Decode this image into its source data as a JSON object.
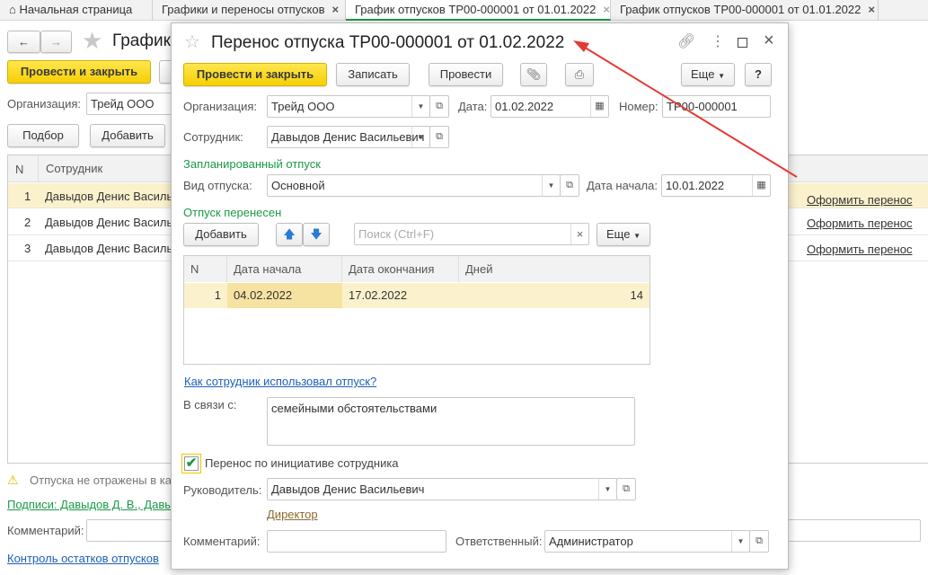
{
  "tabs": [
    {
      "label": "Начальная страница",
      "icon": "home-icon"
    },
    {
      "label": "Графики и переносы отпусков",
      "close": "×"
    },
    {
      "label": "График отпусков ТР00-000001 от 01.01.2022",
      "close": "×",
      "active": true
    },
    {
      "label": "График отпусков ТР00-000001 от 01.01.2022",
      "close": "×"
    }
  ],
  "bg": {
    "title": "График",
    "post_close": "Провести и закрыть",
    "org_label": "Организация:",
    "org_value": "Трейд ООО",
    "pick": "Подбор",
    "add": "Добавить",
    "col_n": "N",
    "col_emp": "Сотрудник",
    "rows": [
      {
        "n": "1",
        "emp": "Давыдов Денис Василь",
        "action": "Оформить перенос"
      },
      {
        "n": "2",
        "emp": "Давыдов Денис Василь",
        "action": "Оформить перенос"
      },
      {
        "n": "3",
        "emp": "Давыдов Денис Василь",
        "action": "Оформить перенос"
      }
    ],
    "warning": "Отпуска не отражены в ка",
    "signatures": "Подписи: Давыдов Д. В., Давы",
    "comment_label": "Комментарий:",
    "control_link": "Контроль остатков отпусков"
  },
  "modal": {
    "title": "Перенос отпуска ТР00-000001 от 01.02.2022",
    "toolbar": {
      "post_close": "Провести и закрыть",
      "save": "Записать",
      "post": "Провести",
      "more": "Еще",
      "help": "?"
    },
    "org_label": "Организация:",
    "org_value": "Трейд ООО",
    "date_label": "Дата:",
    "date_value": "01.02.2022",
    "num_label": "Номер:",
    "num_value": "ТР00-000001",
    "emp_label": "Сотрудник:",
    "emp_value": "Давыдов Денис Васильевич",
    "planned_header": "Запланированный отпуск",
    "type_label": "Вид отпуска:",
    "type_value": "Основной",
    "start_label": "Дата начала:",
    "start_value": "10.01.2022",
    "moved_header": "Отпуск перенесен",
    "add": "Добавить",
    "search_placeholder": "Поиск (Ctrl+F)",
    "more": "Еще",
    "table": {
      "headers": [
        "N",
        "Дата начала",
        "Дата окончания",
        "Дней"
      ],
      "rows": [
        {
          "n": "1",
          "start": "04.02.2022",
          "end": "17.02.2022",
          "days": "14"
        }
      ]
    },
    "usage_link": "Как сотрудник использовал отпуск?",
    "reason_label": "В связи с:",
    "reason_value": "семейными обстоятельствами",
    "initiative_label": "Перенос по инициативе сотрудника",
    "initiative_checked": true,
    "manager_label": "Руководитель:",
    "manager_value": "Давыдов Денис Васильевич",
    "manager_position": "Директор",
    "comment_label": "Комментарий:",
    "comment_value": "",
    "resp_label": "Ответственный:",
    "resp_value": "Администратор"
  },
  "colors": {
    "accent_yellow": "#f5cf05",
    "green": "#1a9a48",
    "link_blue": "#1f5fb5",
    "arrow": "#e53935"
  }
}
